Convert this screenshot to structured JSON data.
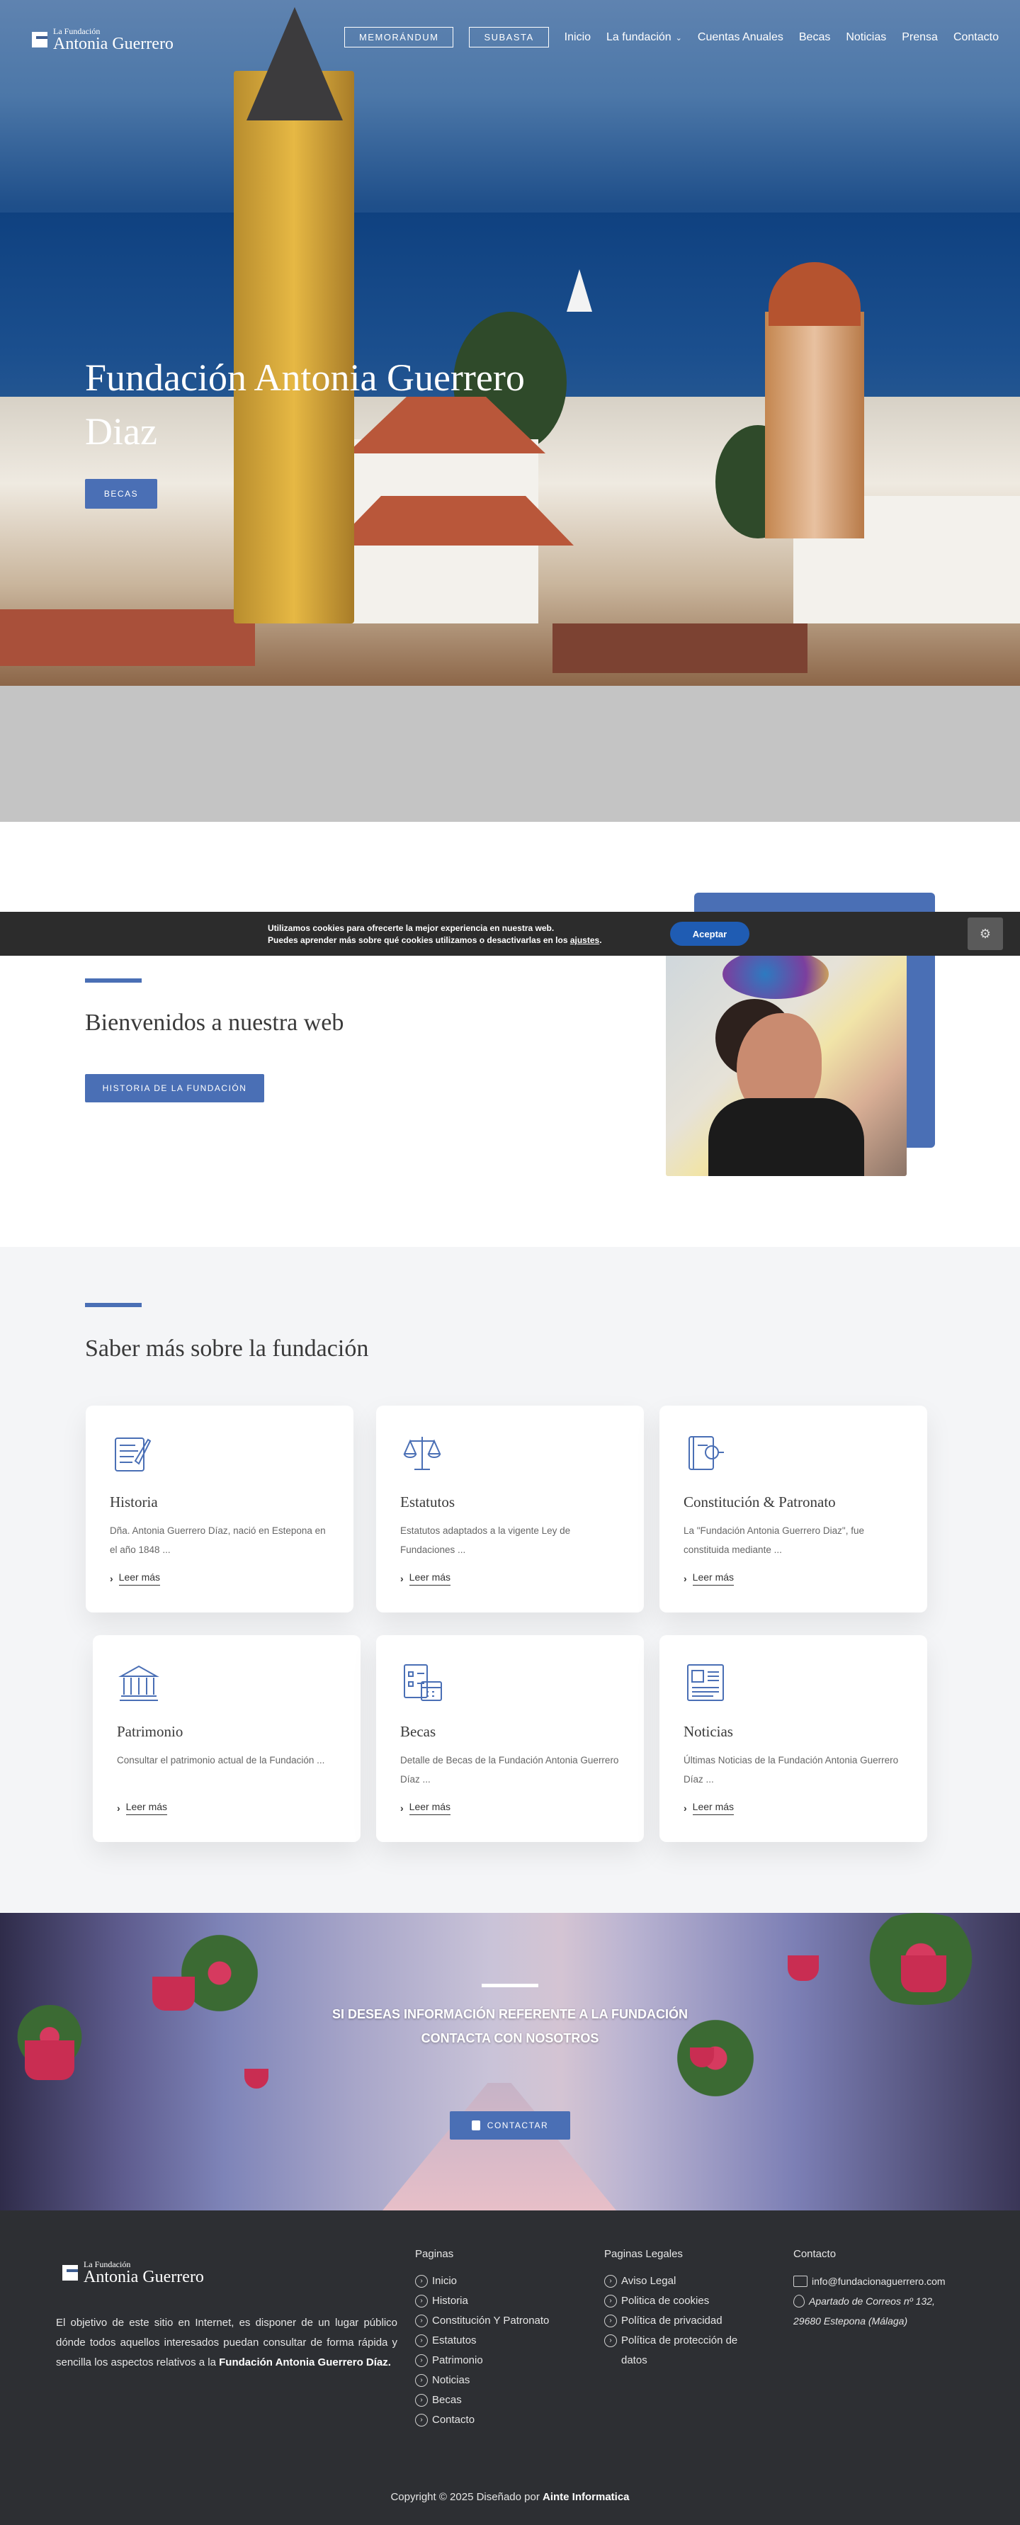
{
  "header": {
    "logo_small": "La Fundación",
    "logo_big": "Antonia Guerrero",
    "memorandum": "MEMORÁNDUM",
    "subasta": "SUBASTA",
    "nav": [
      "Inicio",
      "La fundación",
      "Cuentas Anuales",
      "Becas",
      "Noticias",
      "Prensa",
      "Contacto"
    ]
  },
  "hero": {
    "title": "Fundación Antonia Guerrero Diaz",
    "button": "BECAS"
  },
  "cookie": {
    "line1": "Utilizamos cookies para ofrecerte la mejor experiencia en nuestra web.",
    "line2_pre": "Puedes aprender más sobre qué cookies utilizamos o desactivarlas en los ",
    "line2_link": "ajustes",
    "line2_post": ".",
    "accept": "Aceptar"
  },
  "welcome": {
    "title": "Bienvenidos a nuestra web",
    "button": "HISTORIA DE LA FUNDACIÓN"
  },
  "saber": {
    "title": "Saber más sobre la fundación",
    "more": "Leer más",
    "cards": [
      {
        "icon": "document-quill-icon",
        "title": "Historia",
        "desc": "Dña. Antonia Guerrero Díaz, nació en Estepona en el año 1848 ..."
      },
      {
        "icon": "scales-icon",
        "title": "Estatutos",
        "desc": "Estatutos adaptados a la vigente Ley de Fundaciones ..."
      },
      {
        "icon": "legal-book-icon",
        "title": "Constitución & Patronato",
        "desc": "La \"Fundación Antonia Guerrero Diaz\", fue constituida mediante ..."
      },
      {
        "icon": "building-columns-icon",
        "title": "Patrimonio",
        "desc": "Consultar el patrimonio actual de la Fundación ..."
      },
      {
        "icon": "calendar-checklist-icon",
        "title": "Becas",
        "desc": "Detalle de Becas de la Fundación Antonia Guerrero Díaz ..."
      },
      {
        "icon": "newspaper-icon",
        "title": "Noticias",
        "desc": "Últimas Noticias de la Fundación Antonia Guerrero Díaz ..."
      }
    ]
  },
  "banner": {
    "text": "SI DESEAS INFORMACIÓN REFERENTE A LA FUNDACIÓN CONTACTA CON NOSOTROS",
    "button": "CONTACTAR"
  },
  "footer": {
    "logo_small": "La Fundación",
    "logo_big": "Antonia Guerrero",
    "desc_pre": "El objetivo de este sitio en Internet, es disponer de un lugar público dónde todos aquellos interesados puedan consultar de forma rápida y sencilla los aspectos relativos a la ",
    "desc_bold": "Fundación Antonia Guerrero Díaz.",
    "pages_title": "Paginas",
    "pages": [
      "Inicio",
      "Historia",
      "Constitución Y Patronato",
      "Estatutos",
      "Patrimonio",
      "Noticias",
      "Becas",
      "Contacto"
    ],
    "legal_title": "Paginas Legales",
    "legal": [
      "Aviso Legal",
      "Politica de cookies",
      "Política de privacidad",
      "Política de protección de datos"
    ],
    "contact_title": "Contacto",
    "email": "info@fundacionaguerrero.com",
    "address1": "Apartado de Correos nº 132,",
    "address2": "29680 Estepona (Málaga)",
    "copy_pre": "Copyright © 2025 Diseñado por ",
    "copy_bold": "Ainte Informatica"
  },
  "colors": {
    "accent": "#4a6fb5",
    "footer": "#2d2f33",
    "cookie": "#2c2c2c",
    "accept": "#1f5cb3"
  }
}
